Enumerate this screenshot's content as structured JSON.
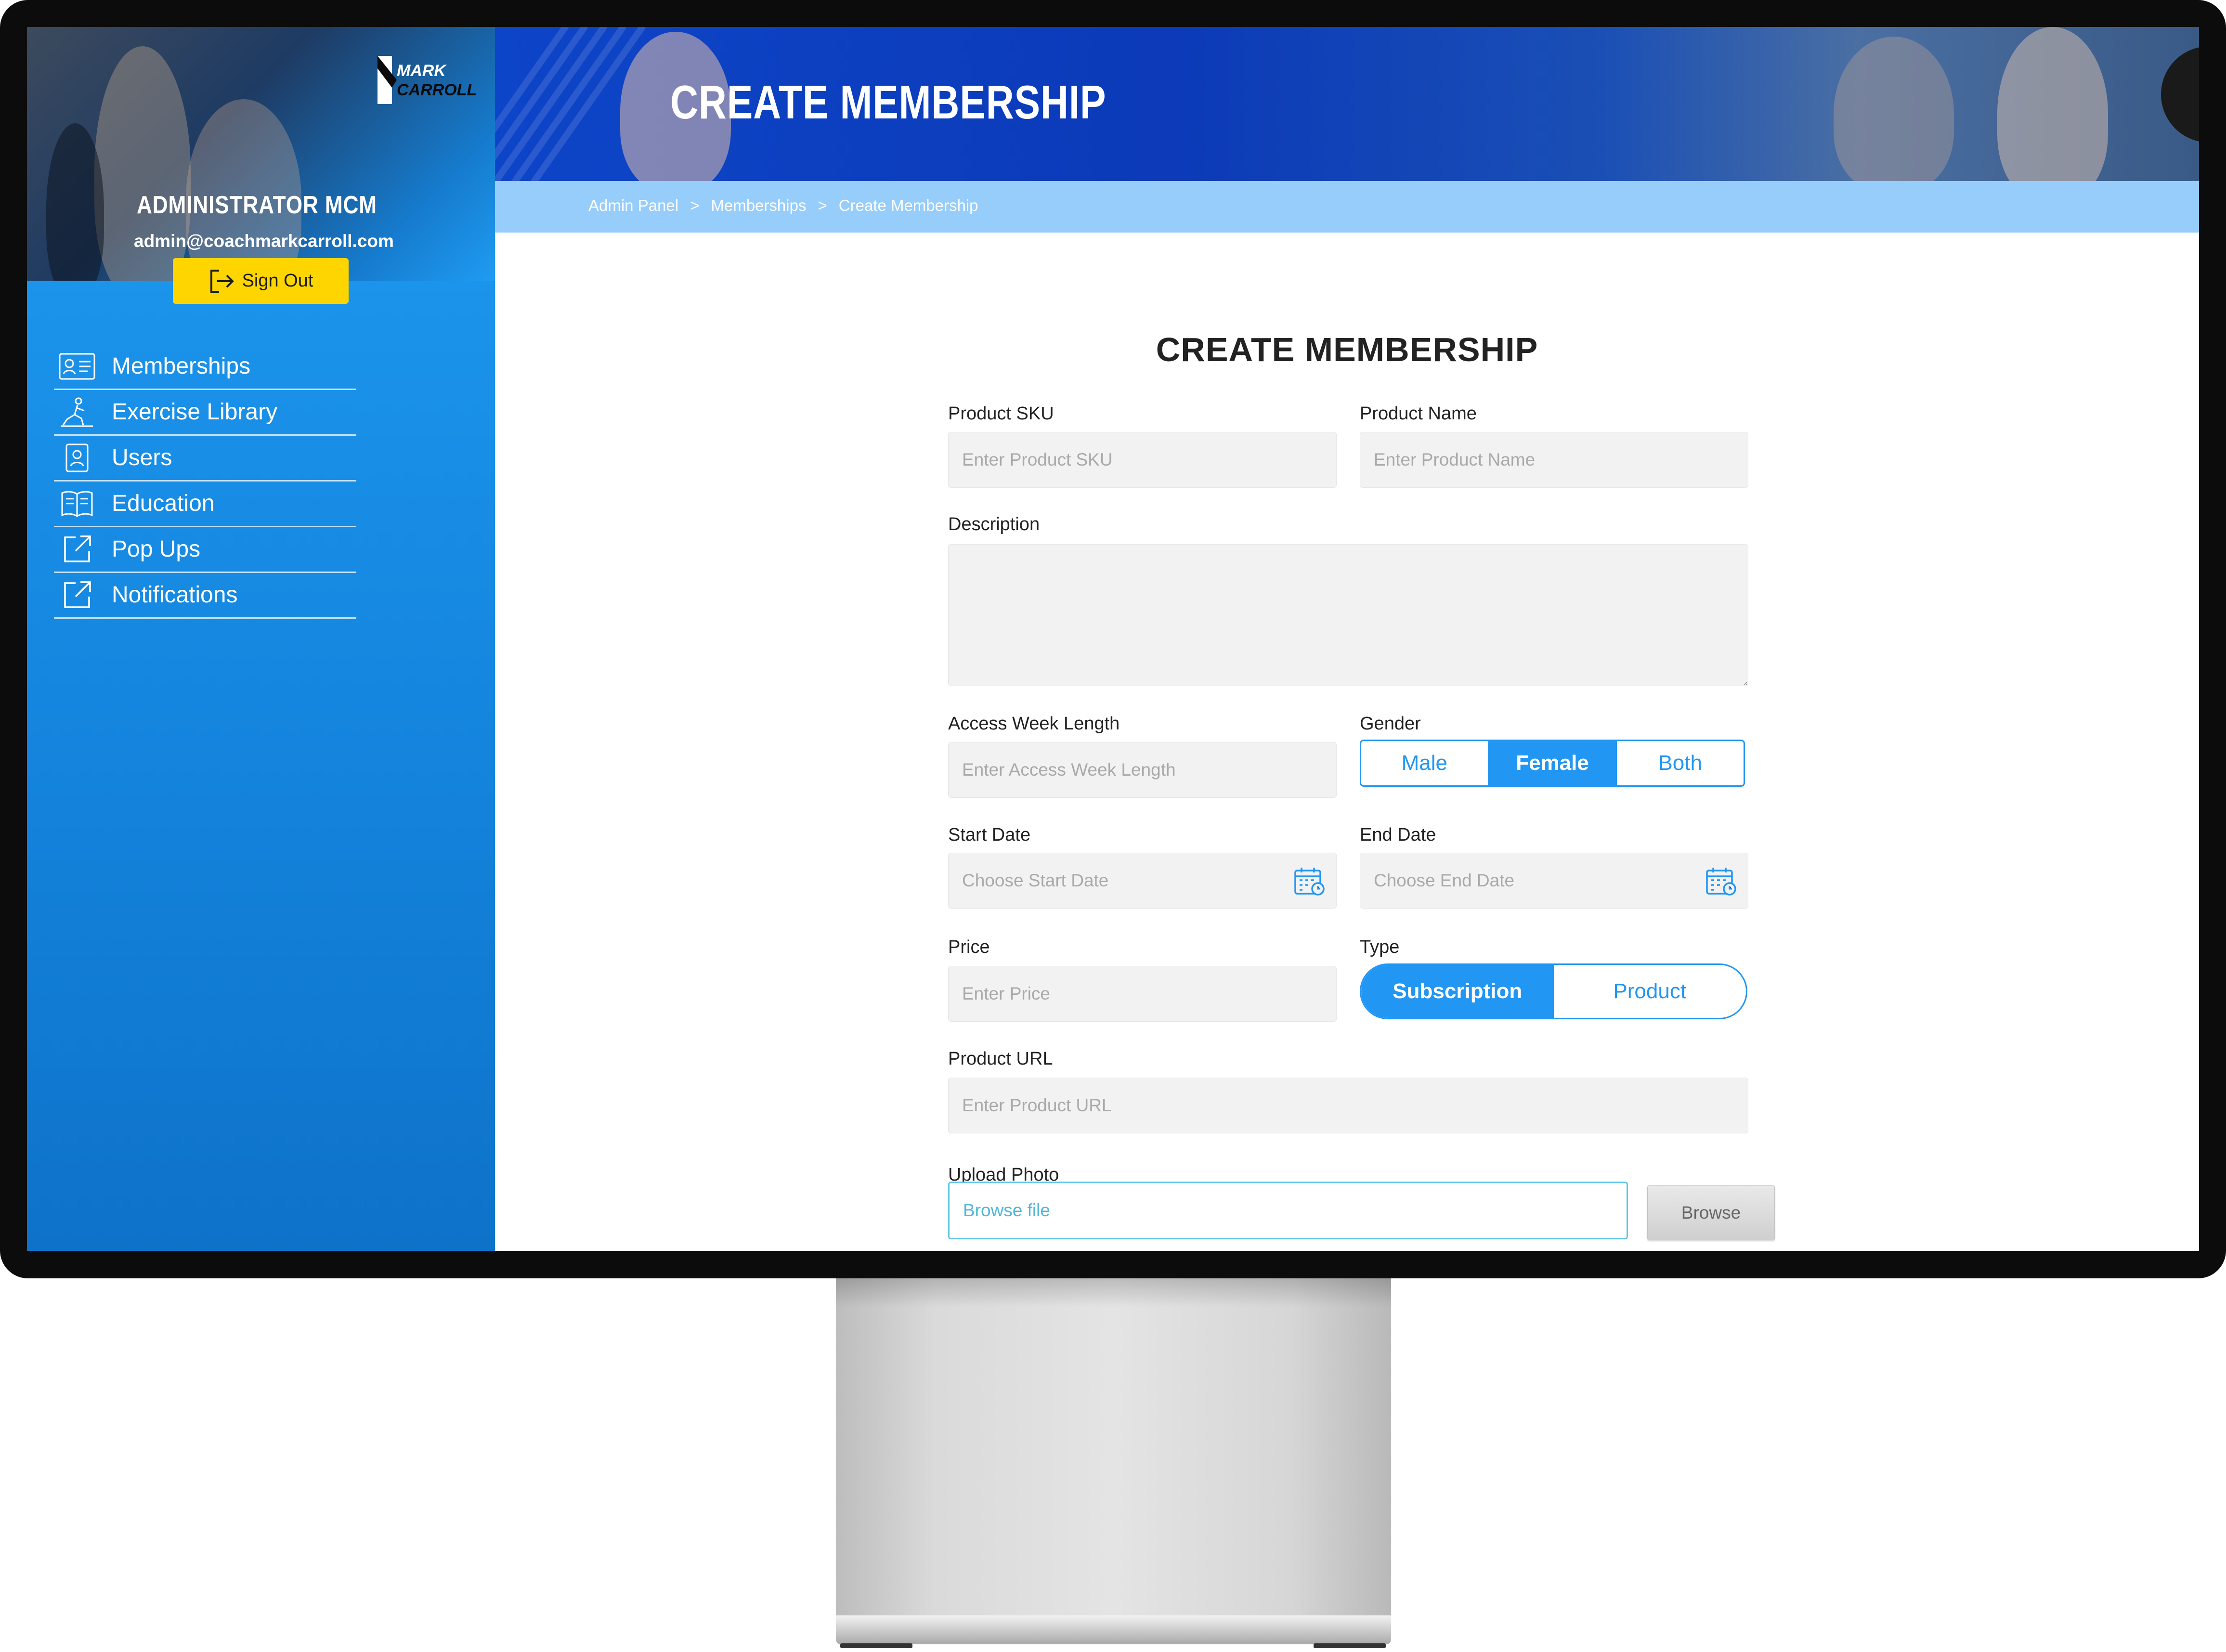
{
  "sidebar": {
    "admin_name": "ADMINISTRATOR MCM",
    "admin_email": "admin@coachmarkcarroll.com",
    "sign_out_label": "Sign Out",
    "logo_text": [
      "MARK",
      "CARROLL"
    ],
    "items": [
      {
        "label": "Memberships",
        "icon": "id-card-icon"
      },
      {
        "label": "Exercise Library",
        "icon": "exercise-icon"
      },
      {
        "label": "Users",
        "icon": "user-badge-icon"
      },
      {
        "label": "Education",
        "icon": "book-icon"
      },
      {
        "label": "Pop Ups",
        "icon": "external-link-icon"
      },
      {
        "label": "Notifications",
        "icon": "external-link-icon"
      }
    ]
  },
  "header": {
    "title": "CREATE MEMBERSHIP",
    "breadcrumbs": [
      "Admin Panel",
      "Memberships",
      "Create Membership"
    ],
    "breadcrumb_separator": ">"
  },
  "form": {
    "title": "CREATE MEMBERSHIP",
    "product_sku": {
      "label": "Product SKU",
      "placeholder": "Enter Product SKU"
    },
    "product_name": {
      "label": "Product Name",
      "placeholder": "Enter Product Name"
    },
    "description": {
      "label": "Description",
      "placeholder": ""
    },
    "access_week_length": {
      "label": "Access Week Length",
      "placeholder": "Enter Access Week Length"
    },
    "gender": {
      "label": "Gender",
      "options": [
        "Male",
        "Female",
        "Both"
      ],
      "selected": "Female"
    },
    "start_date": {
      "label": "Start Date",
      "placeholder": "Choose Start Date"
    },
    "end_date": {
      "label": "End Date",
      "placeholder": "Choose End Date"
    },
    "price": {
      "label": "Price",
      "placeholder": "Enter Price"
    },
    "type": {
      "label": "Type",
      "options": [
        "Subscription",
        "Product"
      ],
      "selected": "Subscription"
    },
    "product_url": {
      "label": "Product URL",
      "placeholder": "Enter Product URL"
    },
    "upload_photo": {
      "label": "Upload Photo",
      "placeholder": "Browse file",
      "button_label": "Browse"
    }
  },
  "colors": {
    "accent": "#2196f3",
    "sidebar": "#1586df",
    "sign_out": "#ffd500",
    "breadcrumb_bar": "#96cdfb",
    "banner": "#0d45c8"
  }
}
